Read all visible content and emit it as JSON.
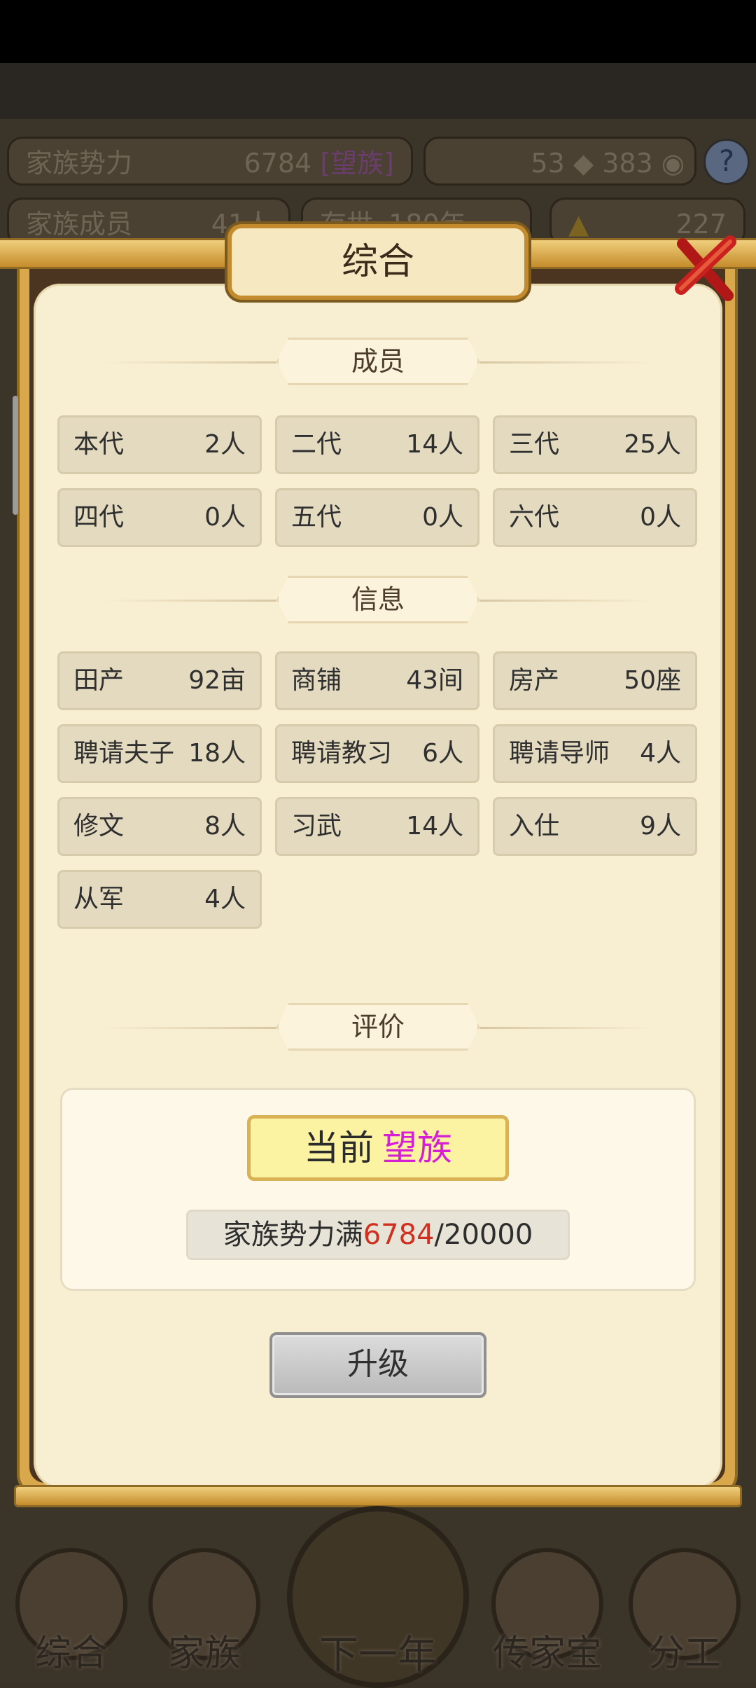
{
  "hud": {
    "power_label": "家族势力",
    "power_value": "6784",
    "rank_bracket": "[望族]",
    "resource_a": "53",
    "resource_b": "383",
    "members_label": "家族成员",
    "members_value": "41人",
    "survive_label": "存世",
    "survive_value": "180年",
    "gold_value": "227"
  },
  "modal": {
    "title": "综合",
    "sections": {
      "members": "成员",
      "info": "信息",
      "evaluation": "评价"
    },
    "generations": [
      {
        "label": "本代",
        "value": "2人"
      },
      {
        "label": "二代",
        "value": "14人"
      },
      {
        "label": "三代",
        "value": "25人"
      },
      {
        "label": "四代",
        "value": "0人"
      },
      {
        "label": "五代",
        "value": "0人"
      },
      {
        "label": "六代",
        "value": "0人"
      }
    ],
    "info": [
      {
        "label": "田产",
        "value": "92亩"
      },
      {
        "label": "商铺",
        "value": "43间"
      },
      {
        "label": "房产",
        "value": "50座"
      },
      {
        "label": "聘请夫子",
        "value": "18人"
      },
      {
        "label": "聘请教习",
        "value": "6人"
      },
      {
        "label": "聘请导师",
        "value": "4人"
      },
      {
        "label": "修文",
        "value": "8人"
      },
      {
        "label": "习武",
        "value": "14人"
      },
      {
        "label": "入仕",
        "value": "9人"
      },
      {
        "label": "从军",
        "value": "4人"
      }
    ],
    "evaluation": {
      "current_prefix": "当前",
      "current_rank": "望族",
      "power_prefix": "家族势力满",
      "power_current": "6784",
      "power_sep": "/",
      "power_max": "20000",
      "rank_color": "#d51fd3",
      "current_color": "#d03020"
    },
    "upgrade_label": "升级"
  },
  "nav": {
    "items": [
      "综合",
      "家族",
      "下一年",
      "传家宝",
      "分工"
    ]
  }
}
